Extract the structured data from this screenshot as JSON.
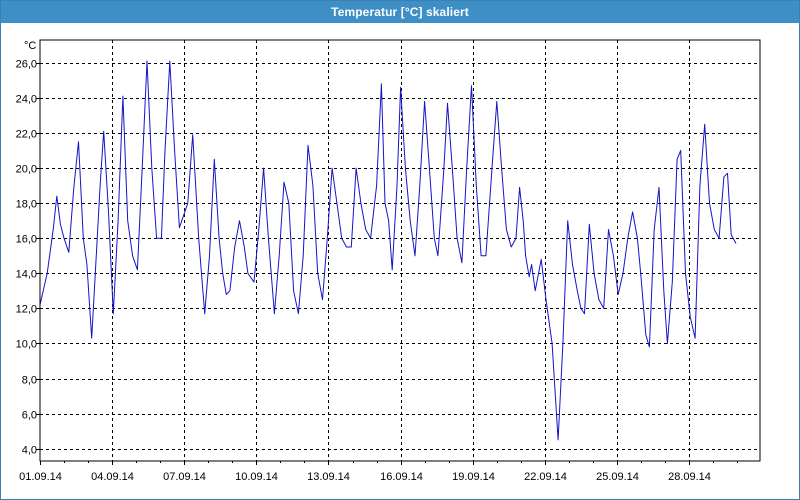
{
  "window": {
    "title": "Temperatur [°C] skaliert"
  },
  "colors": {
    "titlebar": "#3d8fc6",
    "line": "#1414c8",
    "grid": "#000000"
  },
  "chart_data": {
    "type": "line",
    "title": "Temperatur [°C] skaliert",
    "ylabel": "°C",
    "xlabel": "",
    "grid": true,
    "xlim": [
      "01.09.14",
      "01.10.14"
    ],
    "ylim": [
      3.3,
      27.3
    ],
    "yticks": [
      4.0,
      6.0,
      8.0,
      10.0,
      12.0,
      14.0,
      16.0,
      18.0,
      20.0,
      22.0,
      24.0,
      26.0
    ],
    "ytick_labels": [
      "4,0",
      "6,0",
      "8,0",
      "10,0",
      "12,0",
      "14,0",
      "16,0",
      "18,0",
      "20,0",
      "22,0",
      "24,0",
      "26,0"
    ],
    "xtick_labels": [
      "01.09.14",
      "04.09.14",
      "07.09.14",
      "10.09.14",
      "13.09.14",
      "16.09.14",
      "19.09.14",
      "22.09.14",
      "25.09.14",
      "28.09.14"
    ],
    "series": [
      {
        "values": [
          [
            0.0,
            12.2
          ],
          [
            0.3,
            14.0
          ],
          [
            0.55,
            16.5
          ],
          [
            0.7,
            18.4
          ],
          [
            0.85,
            16.8
          ],
          [
            1.0,
            16.0
          ],
          [
            1.2,
            15.2
          ],
          [
            1.4,
            18.8
          ],
          [
            1.6,
            21.5
          ],
          [
            1.8,
            16.0
          ],
          [
            1.95,
            14.5
          ],
          [
            2.15,
            10.3
          ],
          [
            2.3,
            14.0
          ],
          [
            2.5,
            19.0
          ],
          [
            2.65,
            22.1
          ],
          [
            2.85,
            17.5
          ],
          [
            3.05,
            11.7
          ],
          [
            3.25,
            17.0
          ],
          [
            3.45,
            24.1
          ],
          [
            3.65,
            17.0
          ],
          [
            3.85,
            15.0
          ],
          [
            4.05,
            14.2
          ],
          [
            4.25,
            20.0
          ],
          [
            4.45,
            26.1
          ],
          [
            4.65,
            20.0
          ],
          [
            4.85,
            16.0
          ],
          [
            5.05,
            16.0
          ],
          [
            5.2,
            21.0
          ],
          [
            5.4,
            26.1
          ],
          [
            5.6,
            21.0
          ],
          [
            5.8,
            16.6
          ],
          [
            5.95,
            17.2
          ],
          [
            6.15,
            18.0
          ],
          [
            6.35,
            21.9
          ],
          [
            6.6,
            16.0
          ],
          [
            6.85,
            11.7
          ],
          [
            7.05,
            15.0
          ],
          [
            7.25,
            20.5
          ],
          [
            7.45,
            16.0
          ],
          [
            7.6,
            14.0
          ],
          [
            7.75,
            12.8
          ],
          [
            7.9,
            13.0
          ],
          [
            8.1,
            15.5
          ],
          [
            8.3,
            17.0
          ],
          [
            8.5,
            15.5
          ],
          [
            8.65,
            14.0
          ],
          [
            8.9,
            13.5
          ],
          [
            9.1,
            16.5
          ],
          [
            9.3,
            20.0
          ],
          [
            9.5,
            16.0
          ],
          [
            9.75,
            11.7
          ],
          [
            9.95,
            15.0
          ],
          [
            10.15,
            19.2
          ],
          [
            10.35,
            18.0
          ],
          [
            10.55,
            13.0
          ],
          [
            10.75,
            11.7
          ],
          [
            10.95,
            15.0
          ],
          [
            11.15,
            21.3
          ],
          [
            11.35,
            19.0
          ],
          [
            11.55,
            14.0
          ],
          [
            11.75,
            12.5
          ],
          [
            11.95,
            16.0
          ],
          [
            12.15,
            20.0
          ],
          [
            12.35,
            18.0
          ],
          [
            12.55,
            16.0
          ],
          [
            12.75,
            15.5
          ],
          [
            12.95,
            15.5
          ],
          [
            13.15,
            20.0
          ],
          [
            13.35,
            18.0
          ],
          [
            13.55,
            16.5
          ],
          [
            13.75,
            16.0
          ],
          [
            14.0,
            19.0
          ],
          [
            14.2,
            24.8
          ],
          [
            14.35,
            18.0
          ],
          [
            14.5,
            17.0
          ],
          [
            14.65,
            14.2
          ],
          [
            14.85,
            19.0
          ],
          [
            15.0,
            24.6
          ],
          [
            15.2,
            20.0
          ],
          [
            15.4,
            17.0
          ],
          [
            15.6,
            15.0
          ],
          [
            15.8,
            19.0
          ],
          [
            16.0,
            23.8
          ],
          [
            16.2,
            20.0
          ],
          [
            16.4,
            16.0
          ],
          [
            16.55,
            15.0
          ],
          [
            16.8,
            20.0
          ],
          [
            16.95,
            23.7
          ],
          [
            17.15,
            20.0
          ],
          [
            17.35,
            16.0
          ],
          [
            17.55,
            14.6
          ],
          [
            17.75,
            20.0
          ],
          [
            17.95,
            24.7
          ],
          [
            18.15,
            19.0
          ],
          [
            18.35,
            15.0
          ],
          [
            18.55,
            15.0
          ],
          [
            18.8,
            20.0
          ],
          [
            19.0,
            23.8
          ],
          [
            19.2,
            20.0
          ],
          [
            19.4,
            16.5
          ],
          [
            19.6,
            15.5
          ],
          [
            19.8,
            16.0
          ],
          [
            19.95,
            18.9
          ],
          [
            20.1,
            17.0
          ],
          [
            20.2,
            15.0
          ],
          [
            20.35,
            13.8
          ],
          [
            20.45,
            14.5
          ],
          [
            20.6,
            13.0
          ],
          [
            20.85,
            14.8
          ],
          [
            21.05,
            12.5
          ],
          [
            21.3,
            10.0
          ],
          [
            21.55,
            4.5
          ],
          [
            21.75,
            10.0
          ],
          [
            21.95,
            17.0
          ],
          [
            22.15,
            14.5
          ],
          [
            22.35,
            13.0
          ],
          [
            22.5,
            12.0
          ],
          [
            22.65,
            11.7
          ],
          [
            22.85,
            16.8
          ],
          [
            23.05,
            14.0
          ],
          [
            23.25,
            12.5
          ],
          [
            23.45,
            12.0
          ],
          [
            23.65,
            16.5
          ],
          [
            23.85,
            15.0
          ],
          [
            24.05,
            12.8
          ],
          [
            24.25,
            14.0
          ],
          [
            24.45,
            16.0
          ],
          [
            24.65,
            17.5
          ],
          [
            24.85,
            16.0
          ],
          [
            25.0,
            13.8
          ],
          [
            25.2,
            10.5
          ],
          [
            25.35,
            9.8
          ],
          [
            25.55,
            16.5
          ],
          [
            25.75,
            18.9
          ],
          [
            25.95,
            13.0
          ],
          [
            26.1,
            10.0
          ],
          [
            26.3,
            13.5
          ],
          [
            26.5,
            20.5
          ],
          [
            26.65,
            21.0
          ],
          [
            26.85,
            14.0
          ],
          [
            27.05,
            11.5
          ],
          [
            27.25,
            10.3
          ],
          [
            27.45,
            19.0
          ],
          [
            27.65,
            22.5
          ],
          [
            27.85,
            18.0
          ],
          [
            28.05,
            16.5
          ],
          [
            28.25,
            16.0
          ],
          [
            28.45,
            19.5
          ],
          [
            28.6,
            19.7
          ],
          [
            28.75,
            16.2
          ],
          [
            28.95,
            15.7
          ]
        ]
      }
    ]
  }
}
